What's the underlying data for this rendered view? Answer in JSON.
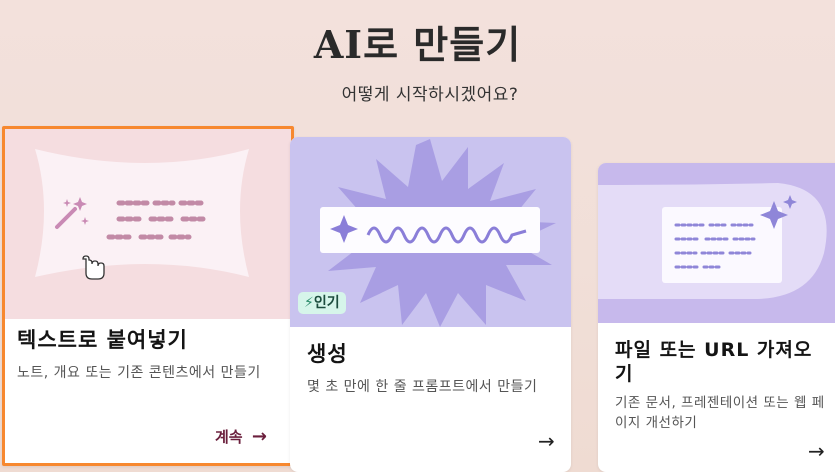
{
  "header": {
    "title": "AI로 만들기",
    "subtitle": "어떻게 시작하시겠어요?"
  },
  "cards": [
    {
      "title": "텍스트로 붙여넣기",
      "description": "노트, 개요 또는 기존 콘텐츠에서 만들기",
      "action_label": "계속",
      "action_icon": "arrow-right-icon",
      "accent": "#f7882f"
    },
    {
      "badge": "인기",
      "badge_icon": "lightning-icon",
      "title": "생성",
      "description": "몇 초 만에 한 줄 프롬프트에서 만들기",
      "action_icon": "arrow-right-icon"
    },
    {
      "title": "파일 또는 URL 가져오기",
      "description": "기존 문서, 프레젠테이션 또는 웹 페이지 개선하기",
      "action_icon": "arrow-right-icon"
    }
  ],
  "colors": {
    "background": "#f2e0da",
    "selected_border": "#f7882f",
    "continue_text": "#6b1f3c",
    "badge_bg": "#d6f5ea",
    "purple_art": "#c4bdf0"
  }
}
